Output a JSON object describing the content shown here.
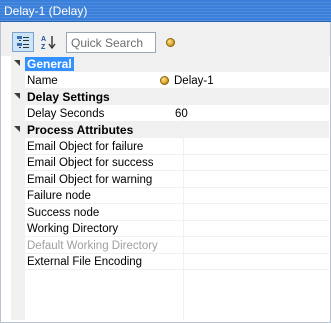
{
  "window": {
    "title": "Delay-1 (Delay)"
  },
  "toolbar": {
    "categorized_icon": "categorized-icon",
    "alphabetical_icon": "sort-alphabetical-icon",
    "search_placeholder": "Quick Search",
    "info_icon": "property-info-icon"
  },
  "grid": {
    "categories": [
      {
        "label": "General",
        "selected": true,
        "rows": [
          {
            "name": "Name",
            "value": "Delay-1",
            "value_icon": "gold-dot-icon",
            "disabled": false
          }
        ]
      },
      {
        "label": "Delay Settings",
        "selected": false,
        "rows": [
          {
            "name": "Delay Seconds",
            "value": "60",
            "disabled": false
          }
        ]
      },
      {
        "label": "Process Attributes",
        "selected": false,
        "rows": [
          {
            "name": "Email Object for failure",
            "value": "",
            "disabled": false
          },
          {
            "name": "Email Object for success",
            "value": "",
            "disabled": false
          },
          {
            "name": "Email Object for warning",
            "value": "",
            "disabled": false
          },
          {
            "name": "Failure node",
            "value": "",
            "disabled": false
          },
          {
            "name": "Success node",
            "value": "",
            "disabled": false
          },
          {
            "name": "Working Directory",
            "value": "",
            "disabled": false
          },
          {
            "name": "Default Working Directory",
            "value": "",
            "disabled": true
          },
          {
            "name": "External File Encoding",
            "value": "",
            "disabled": false
          }
        ]
      }
    ]
  },
  "colors": {
    "titlebar": "#3a7fd9",
    "selection": "#3390ff",
    "category_bg": "#f0f0f0",
    "disabled_text": "#a0a0a0"
  }
}
